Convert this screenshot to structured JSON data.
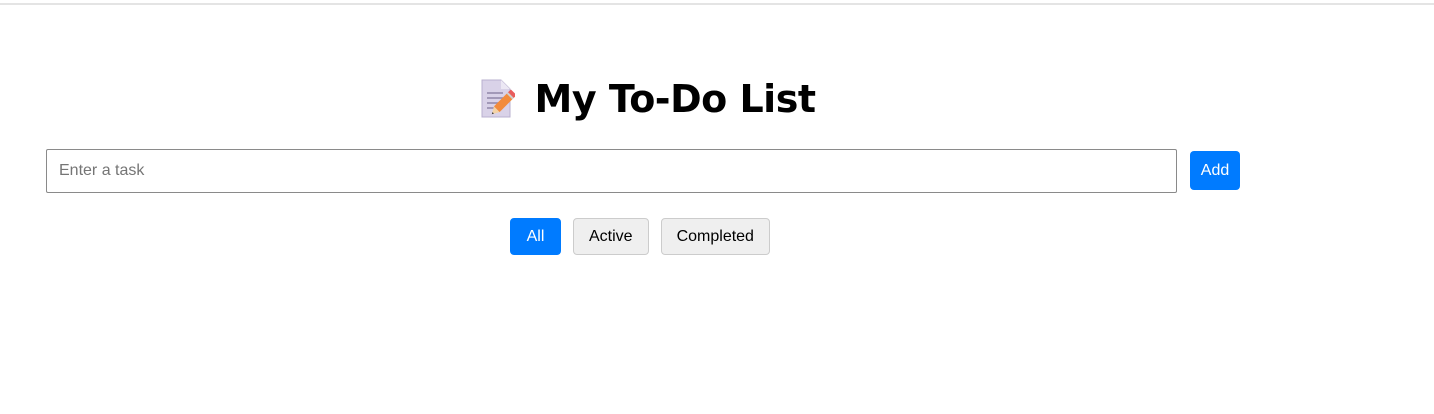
{
  "header": {
    "icon": "memo-pencil-icon",
    "title": "My To-Do List"
  },
  "task_form": {
    "input_placeholder": "Enter a task",
    "input_value": "",
    "add_label": "Add"
  },
  "filters": {
    "items": [
      {
        "label": "All",
        "active": true
      },
      {
        "label": "Active",
        "active": false
      },
      {
        "label": "Completed",
        "active": false
      }
    ]
  },
  "colors": {
    "accent": "#007bff",
    "filter_inactive_bg": "#efefef"
  }
}
